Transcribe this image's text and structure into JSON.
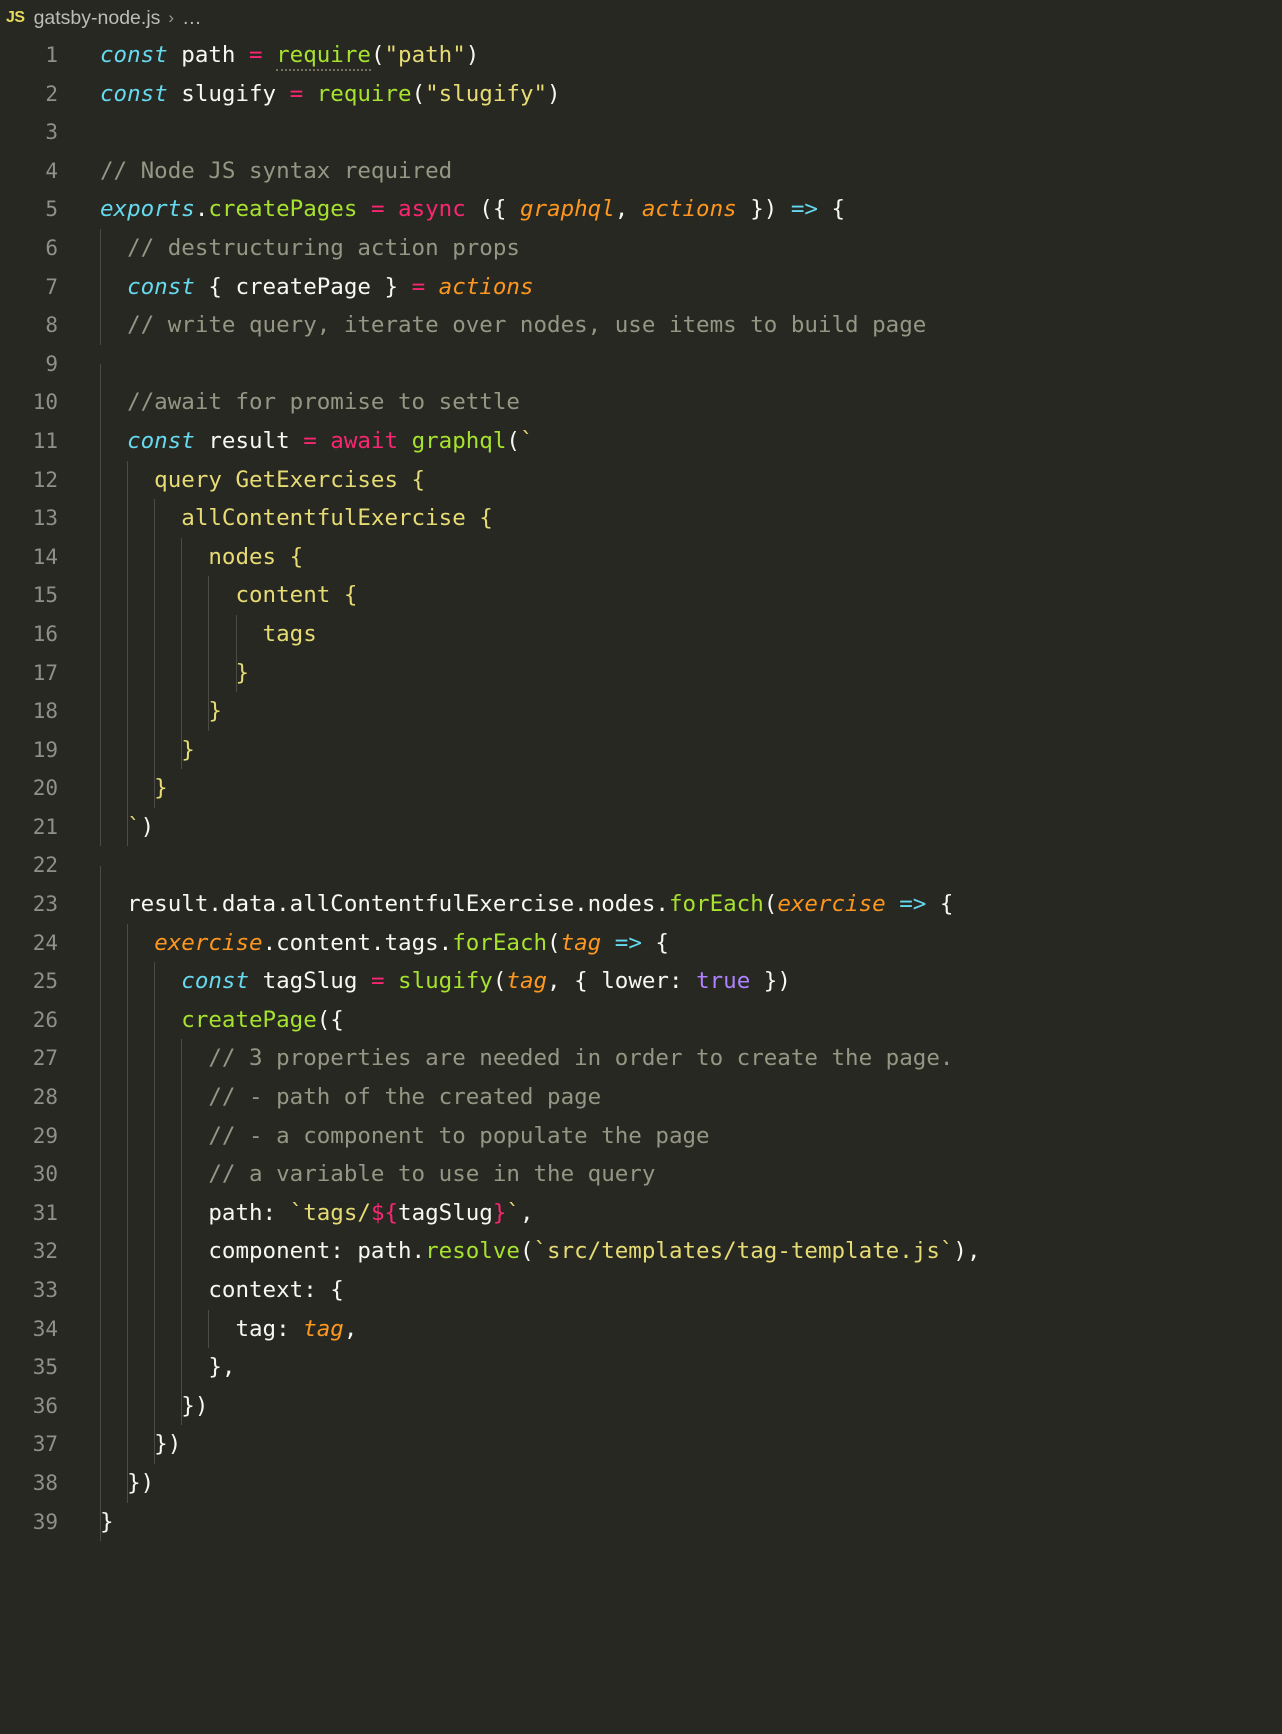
{
  "breadcrumb": {
    "language_badge": "JS",
    "file_name": "gatsby-node.js",
    "separator": "›",
    "ellipsis": "…"
  },
  "editor": {
    "theme_background": "#272822",
    "gutter_color": "#8f908a",
    "indent_guide_color": "#4b4c45",
    "first_line": 1,
    "last_line": 39,
    "total_lines": 39,
    "colors": {
      "keyword": "#66d9ef",
      "function": "#a6e22e",
      "operator": "#f92672",
      "parameter": "#fd971f",
      "string": "#e6db74",
      "comment": "#959684",
      "constant": "#ae81ff",
      "plain_text": "#f8f8f2",
      "badge_yellow": "#e6db5a"
    }
  },
  "lines": [
    {
      "n": 1,
      "guides": 0,
      "tokens": [
        {
          "t": "const",
          "c": "kw"
        },
        {
          "t": " ",
          "c": "plain"
        },
        {
          "t": "path",
          "c": "plain"
        },
        {
          "t": " ",
          "c": "plain"
        },
        {
          "t": "=",
          "c": "op"
        },
        {
          "t": " ",
          "c": "plain"
        },
        {
          "t": "require",
          "c": "fn dotted"
        },
        {
          "t": "(",
          "c": "plain"
        },
        {
          "t": "\"path\"",
          "c": "str"
        },
        {
          "t": ")",
          "c": "plain"
        }
      ]
    },
    {
      "n": 2,
      "guides": 0,
      "tokens": [
        {
          "t": "const",
          "c": "kw"
        },
        {
          "t": " ",
          "c": "plain"
        },
        {
          "t": "slugify",
          "c": "plain"
        },
        {
          "t": " ",
          "c": "plain"
        },
        {
          "t": "=",
          "c": "op"
        },
        {
          "t": " ",
          "c": "plain"
        },
        {
          "t": "require",
          "c": "fn"
        },
        {
          "t": "(",
          "c": "plain"
        },
        {
          "t": "\"slugify\"",
          "c": "str"
        },
        {
          "t": ")",
          "c": "plain"
        }
      ]
    },
    {
      "n": 3,
      "guides": 0,
      "tokens": []
    },
    {
      "n": 4,
      "guides": 0,
      "tokens": [
        {
          "t": "// Node JS syntax required",
          "c": "cmt"
        }
      ]
    },
    {
      "n": 5,
      "guides": 0,
      "tokens": [
        {
          "t": "exports",
          "c": "kw"
        },
        {
          "t": ".",
          "c": "plain"
        },
        {
          "t": "createPages",
          "c": "fn"
        },
        {
          "t": " ",
          "c": "plain"
        },
        {
          "t": "=",
          "c": "op"
        },
        {
          "t": " ",
          "c": "plain"
        },
        {
          "t": "async",
          "c": "op"
        },
        {
          "t": " ({ ",
          "c": "plain"
        },
        {
          "t": "graphql",
          "c": "param"
        },
        {
          "t": ", ",
          "c": "plain"
        },
        {
          "t": "actions",
          "c": "param"
        },
        {
          "t": " }) ",
          "c": "plain"
        },
        {
          "t": "=>",
          "c": "arrow"
        },
        {
          "t": " {",
          "c": "plain"
        }
      ]
    },
    {
      "n": 6,
      "guides": 1,
      "tokens": [
        {
          "t": "  // destructuring action props",
          "c": "cmt"
        }
      ]
    },
    {
      "n": 7,
      "guides": 1,
      "tokens": [
        {
          "t": "  ",
          "c": "plain"
        },
        {
          "t": "const",
          "c": "kw"
        },
        {
          "t": " { ",
          "c": "plain"
        },
        {
          "t": "createPage",
          "c": "plain"
        },
        {
          "t": " } ",
          "c": "plain"
        },
        {
          "t": "=",
          "c": "op"
        },
        {
          "t": " ",
          "c": "plain"
        },
        {
          "t": "actions",
          "c": "param"
        }
      ]
    },
    {
      "n": 8,
      "guides": 1,
      "tokens": [
        {
          "t": "  // write query, iterate over nodes, use items to build page",
          "c": "cmt"
        }
      ]
    },
    {
      "n": 9,
      "guides": 1,
      "tokens": []
    },
    {
      "n": 10,
      "guides": 1,
      "tokens": [
        {
          "t": "  //await for promise to settle",
          "c": "cmt"
        }
      ]
    },
    {
      "n": 11,
      "guides": 1,
      "tokens": [
        {
          "t": "  ",
          "c": "plain"
        },
        {
          "t": "const",
          "c": "kw"
        },
        {
          "t": " ",
          "c": "plain"
        },
        {
          "t": "result",
          "c": "plain"
        },
        {
          "t": " ",
          "c": "plain"
        },
        {
          "t": "=",
          "c": "op"
        },
        {
          "t": " ",
          "c": "plain"
        },
        {
          "t": "await",
          "c": "op"
        },
        {
          "t": " ",
          "c": "plain"
        },
        {
          "t": "graphql",
          "c": "fn"
        },
        {
          "t": "(",
          "c": "plain"
        },
        {
          "t": "`",
          "c": "str"
        }
      ]
    },
    {
      "n": 12,
      "guides": 2,
      "tokens": [
        {
          "t": "    query GetExercises {",
          "c": "str"
        }
      ]
    },
    {
      "n": 13,
      "guides": 3,
      "tokens": [
        {
          "t": "      allContentfulExercise {",
          "c": "str"
        }
      ]
    },
    {
      "n": 14,
      "guides": 4,
      "tokens": [
        {
          "t": "        nodes {",
          "c": "str"
        }
      ]
    },
    {
      "n": 15,
      "guides": 5,
      "tokens": [
        {
          "t": "          content {",
          "c": "str"
        }
      ]
    },
    {
      "n": 16,
      "guides": 6,
      "tokens": [
        {
          "t": "            tags",
          "c": "str"
        }
      ]
    },
    {
      "n": 17,
      "guides": 6,
      "tokens": [
        {
          "t": "          }",
          "c": "str"
        }
      ]
    },
    {
      "n": 18,
      "guides": 5,
      "tokens": [
        {
          "t": "        }",
          "c": "str"
        }
      ]
    },
    {
      "n": 19,
      "guides": 4,
      "tokens": [
        {
          "t": "      }",
          "c": "str"
        }
      ]
    },
    {
      "n": 20,
      "guides": 3,
      "tokens": [
        {
          "t": "    }",
          "c": "str"
        }
      ]
    },
    {
      "n": 21,
      "guides": 2,
      "tokens": [
        {
          "t": "  ",
          "c": "plain"
        },
        {
          "t": "`",
          "c": "str"
        },
        {
          "t": ")",
          "c": "plain"
        }
      ]
    },
    {
      "n": 22,
      "guides": 1,
      "tokens": []
    },
    {
      "n": 23,
      "guides": 1,
      "tokens": [
        {
          "t": "  result",
          "c": "plain"
        },
        {
          "t": ".data.allContentfulExercise.nodes.",
          "c": "plain"
        },
        {
          "t": "forEach",
          "c": "fn"
        },
        {
          "t": "(",
          "c": "plain"
        },
        {
          "t": "exercise",
          "c": "param"
        },
        {
          "t": " ",
          "c": "plain"
        },
        {
          "t": "=>",
          "c": "arrow"
        },
        {
          "t": " {",
          "c": "plain"
        }
      ]
    },
    {
      "n": 24,
      "guides": 2,
      "tokens": [
        {
          "t": "    ",
          "c": "plain"
        },
        {
          "t": "exercise",
          "c": "param"
        },
        {
          "t": ".content.tags.",
          "c": "plain"
        },
        {
          "t": "forEach",
          "c": "fn"
        },
        {
          "t": "(",
          "c": "plain"
        },
        {
          "t": "tag",
          "c": "param"
        },
        {
          "t": " ",
          "c": "plain"
        },
        {
          "t": "=>",
          "c": "arrow"
        },
        {
          "t": " {",
          "c": "plain"
        }
      ]
    },
    {
      "n": 25,
      "guides": 3,
      "tokens": [
        {
          "t": "      ",
          "c": "plain"
        },
        {
          "t": "const",
          "c": "kw"
        },
        {
          "t": " ",
          "c": "plain"
        },
        {
          "t": "tagSlug",
          "c": "plain"
        },
        {
          "t": " ",
          "c": "plain"
        },
        {
          "t": "=",
          "c": "op"
        },
        {
          "t": " ",
          "c": "plain"
        },
        {
          "t": "slugify",
          "c": "fn"
        },
        {
          "t": "(",
          "c": "plain"
        },
        {
          "t": "tag",
          "c": "param"
        },
        {
          "t": ", { lower: ",
          "c": "plain"
        },
        {
          "t": "true",
          "c": "num"
        },
        {
          "t": " })",
          "c": "plain"
        }
      ]
    },
    {
      "n": 26,
      "guides": 3,
      "tokens": [
        {
          "t": "      ",
          "c": "plain"
        },
        {
          "t": "createPage",
          "c": "fn"
        },
        {
          "t": "({",
          "c": "plain"
        }
      ]
    },
    {
      "n": 27,
      "guides": 4,
      "tokens": [
        {
          "t": "        // 3 properties are needed in order to create the page.",
          "c": "cmt"
        }
      ]
    },
    {
      "n": 28,
      "guides": 4,
      "tokens": [
        {
          "t": "        // - path of the created page",
          "c": "cmt"
        }
      ]
    },
    {
      "n": 29,
      "guides": 4,
      "tokens": [
        {
          "t": "        // - a component to populate the page",
          "c": "cmt"
        }
      ]
    },
    {
      "n": 30,
      "guides": 4,
      "tokens": [
        {
          "t": "        // a variable to use in the query",
          "c": "cmt"
        }
      ]
    },
    {
      "n": 31,
      "guides": 4,
      "tokens": [
        {
          "t": "        path: ",
          "c": "plain"
        },
        {
          "t": "`tags/",
          "c": "str"
        },
        {
          "t": "${",
          "c": "op"
        },
        {
          "t": "tagSlug",
          "c": "plain"
        },
        {
          "t": "}",
          "c": "op"
        },
        {
          "t": "`",
          "c": "str"
        },
        {
          "t": ",",
          "c": "plain"
        }
      ]
    },
    {
      "n": 32,
      "guides": 4,
      "tokens": [
        {
          "t": "        component: path.",
          "c": "plain"
        },
        {
          "t": "resolve",
          "c": "fn"
        },
        {
          "t": "(",
          "c": "plain"
        },
        {
          "t": "`src/templates/tag-template.js`",
          "c": "str"
        },
        {
          "t": "),",
          "c": "plain"
        }
      ]
    },
    {
      "n": 33,
      "guides": 4,
      "tokens": [
        {
          "t": "        context: {",
          "c": "plain"
        }
      ]
    },
    {
      "n": 34,
      "guides": 5,
      "tokens": [
        {
          "t": "          tag: ",
          "c": "plain"
        },
        {
          "t": "tag",
          "c": "param"
        },
        {
          "t": ",",
          "c": "plain"
        }
      ]
    },
    {
      "n": 35,
      "guides": 4,
      "tokens": [
        {
          "t": "        },",
          "c": "plain"
        }
      ]
    },
    {
      "n": 36,
      "guides": 4,
      "tokens": [
        {
          "t": "      })",
          "c": "plain"
        }
      ]
    },
    {
      "n": 37,
      "guides": 3,
      "tokens": [
        {
          "t": "    })",
          "c": "plain"
        }
      ]
    },
    {
      "n": 38,
      "guides": 2,
      "tokens": [
        {
          "t": "  })",
          "c": "plain"
        }
      ]
    },
    {
      "n": 39,
      "guides": 1,
      "tokens": [
        {
          "t": "}",
          "c": "plain"
        }
      ]
    }
  ]
}
